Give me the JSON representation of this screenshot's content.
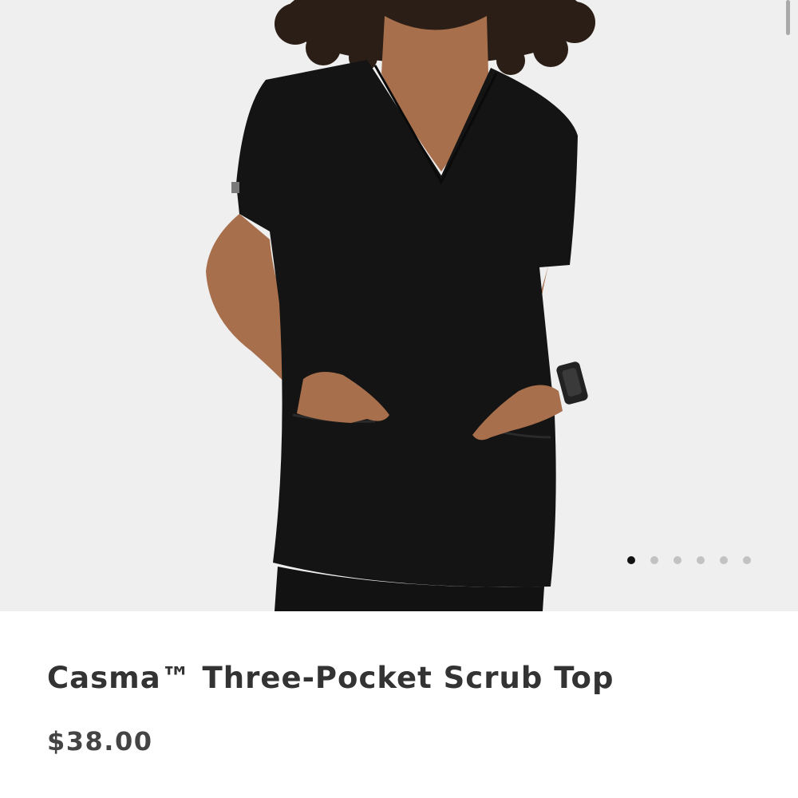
{
  "product": {
    "image_alt": "Model wearing black V-neck three-pocket scrub top",
    "title": "Casma™ Three-Pocket Scrub Top",
    "price": "$38.00",
    "colors": {
      "garment": "#141414",
      "background": "#efefef",
      "skin": "#a86f4c"
    }
  },
  "carousel": {
    "slide_count": 6,
    "active_index": 0
  }
}
